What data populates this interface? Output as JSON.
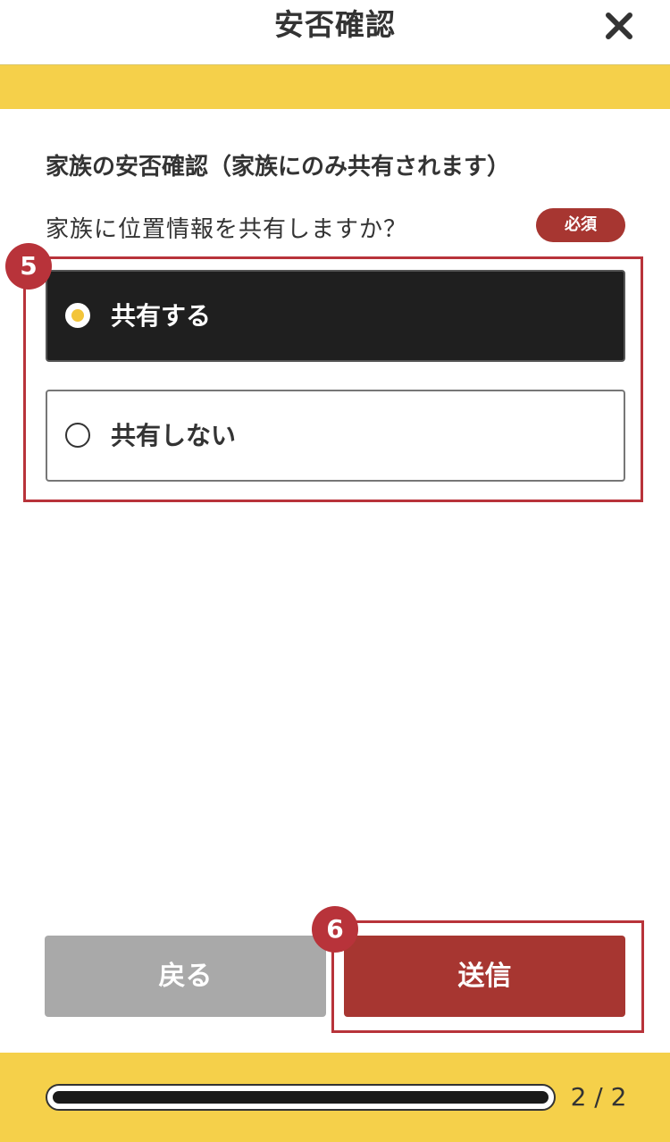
{
  "header": {
    "title": "安否確認",
    "close_icon": "close-icon"
  },
  "section": {
    "title": "家族の安否確認（家族にのみ共有されます）",
    "question": "家族に位置情報を共有しますか？",
    "required_label": "必須"
  },
  "options": [
    {
      "label": "共有する",
      "selected": true
    },
    {
      "label": "共有しない",
      "selected": false
    }
  ],
  "annotations": {
    "step_options": "5",
    "step_submit": "6"
  },
  "buttons": {
    "back_label": "戻る",
    "submit_label": "送信"
  },
  "progress": {
    "current": 2,
    "total": 2,
    "fraction": 1.0,
    "label": "2 / 2"
  },
  "colors": {
    "accent_yellow": "#f5d04a",
    "primary_red": "#a73631",
    "annotation_red": "#b8333a",
    "selected_bg": "#1f1f1f",
    "disabled_gray": "#a9a9a9"
  }
}
